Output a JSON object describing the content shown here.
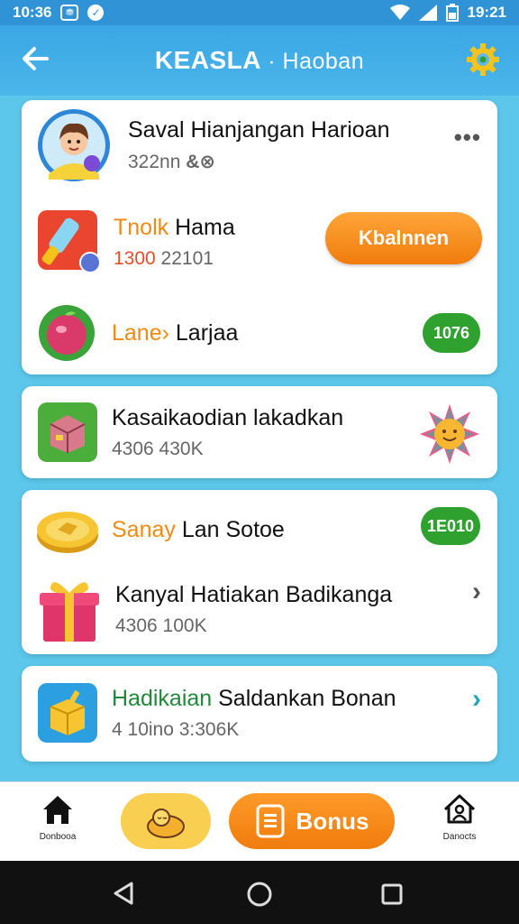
{
  "status_bar": {
    "time": "10:36",
    "battery_text": "19:21"
  },
  "app_bar": {
    "title": "KEASLA",
    "subtitle": "· Haoban"
  },
  "profile_card": {
    "title": "Saval Hianjangan Harioan",
    "subtitle": "322nn",
    "more": "•••",
    "task1": {
      "title_orange": "Tnolk",
      "title_rest": " Hama",
      "value_orange": "1300",
      "value_rest": " 22101",
      "button": "Kbalnnen"
    },
    "task2": {
      "title_orange": "Lanе›",
      "title_rest": " Larjaa",
      "badge": "1076"
    }
  },
  "card2": {
    "title": "Kasaikaodian lakadkan",
    "subtitle": "4306 430K"
  },
  "card3": {
    "item1": {
      "title_orange": "Sanay",
      "title_rest": " Lan Sotoe",
      "badge": "1E010"
    },
    "item2": {
      "title": "Kanyal Hatiakan Badikanga",
      "subtitle": "4306 100K"
    }
  },
  "card4": {
    "title_green": "Hadikaian",
    "title_rest": " Saldankan Bonan",
    "subtitle": "4 10ino 3:306K"
  },
  "bottom_nav": {
    "home_label": "Donbooa",
    "bonus_label": "Bonus",
    "profile_label": "Danocts"
  },
  "colors": {
    "header": "#3aa6e4",
    "accent_orange": "#f07c0c",
    "accent_green": "#2ea12e",
    "background": "#5cc7ea"
  }
}
